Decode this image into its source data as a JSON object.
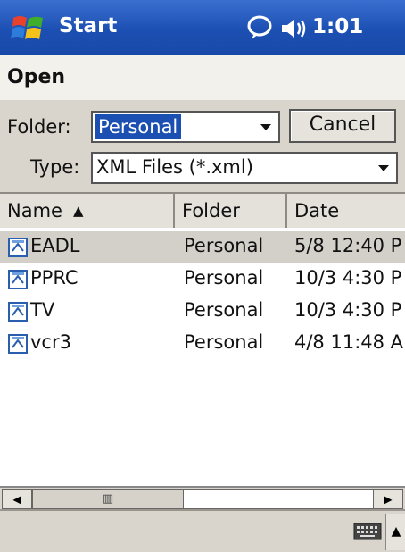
{
  "titlebar": {
    "title": "Start",
    "time": "1:01"
  },
  "header": {
    "title": "Open"
  },
  "form": {
    "folder_label": "Folder:",
    "folder_value": "Personal",
    "type_label": "Type:",
    "type_value": "XML Files (*.xml)",
    "cancel_label": "Cancel"
  },
  "list": {
    "columns": [
      "Name",
      "Folder",
      "Date"
    ],
    "rows": [
      {
        "name": "EADL",
        "folder": "Personal",
        "date": "5/8 12:40 P"
      },
      {
        "name": "PPRC",
        "folder": "Personal",
        "date": "10/3 4:30 P"
      },
      {
        "name": "TV",
        "folder": "Personal",
        "date": "10/3 4:30 P"
      },
      {
        "name": "vcr3",
        "folder": "Personal",
        "date": "4/8 11:48 A"
      }
    ]
  },
  "icons": {
    "windows_logo": "windows-flag-icon",
    "notify": "speech-bubble-icon",
    "volume": "speaker-icon",
    "keyboard": "keyboard-icon"
  },
  "colors": {
    "titlebar": "#1c4fb2",
    "selection": "#1c4fb2"
  }
}
